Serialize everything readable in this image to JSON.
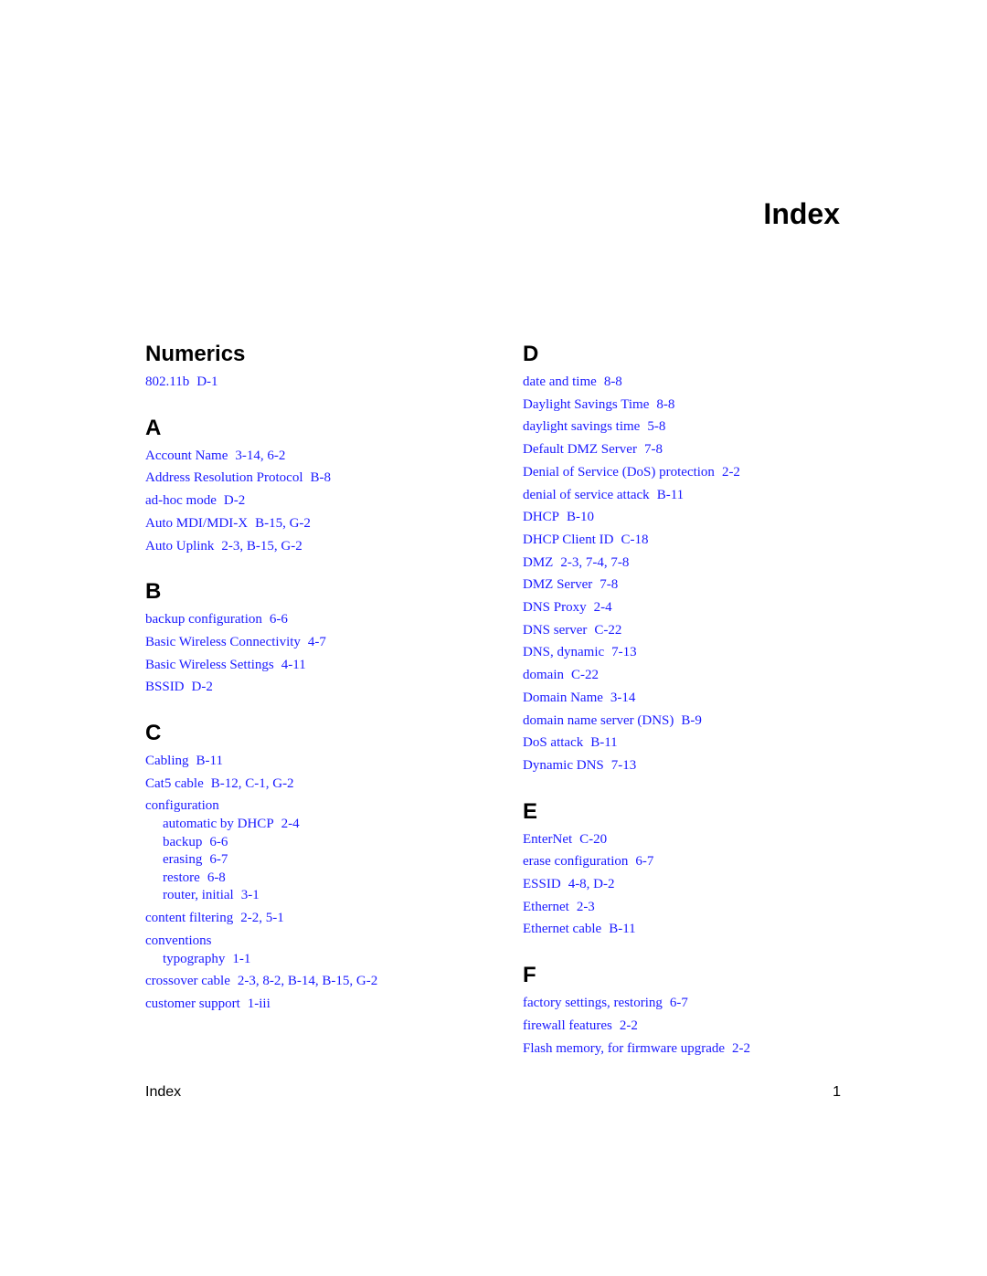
{
  "page": {
    "title": "Index",
    "link_color": "#1a1aff"
  },
  "sections": {
    "numerics": {
      "letter": "Numerics",
      "entries": [
        {
          "term": "802.11b",
          "pages": "D-1"
        }
      ]
    },
    "a": {
      "letter": "A",
      "entries": [
        {
          "term": "Account Name",
          "pages": "3-14, 6-2"
        },
        {
          "term": "Address Resolution Protocol",
          "pages": "B-8"
        },
        {
          "term": "ad-hoc mode",
          "pages": "D-2"
        },
        {
          "term": "Auto MDI/MDI-X",
          "pages": "B-15, G-2"
        },
        {
          "term": "Auto Uplink",
          "pages": "2-3, B-15, G-2"
        }
      ]
    },
    "b": {
      "letter": "B",
      "entries": [
        {
          "term": "backup configuration",
          "pages": "6-6"
        },
        {
          "term": "Basic Wireless Connectivity",
          "pages": "4-7"
        },
        {
          "term": "Basic Wireless Settings",
          "pages": "4-11"
        },
        {
          "term": "BSSID",
          "pages": "D-2"
        }
      ]
    },
    "c": {
      "letter": "C",
      "entries": [
        {
          "term": "Cabling",
          "pages": "B-11"
        },
        {
          "term": "Cat5 cable",
          "pages": "B-12, C-1, G-2"
        }
      ],
      "configuration": {
        "term": "configuration",
        "subentries": [
          {
            "term": "automatic by DHCP",
            "pages": "2-4"
          },
          {
            "term": "backup",
            "pages": "6-6"
          },
          {
            "term": "erasing",
            "pages": "6-7"
          },
          {
            "term": "restore",
            "pages": "6-8"
          },
          {
            "term": "router, initial",
            "pages": "3-1"
          }
        ]
      },
      "content_filtering": {
        "term": "content filtering",
        "pages": "2-2, 5-1"
      },
      "conventions": {
        "term": "conventions",
        "subentries": [
          {
            "term": "typography",
            "pages": "1-1"
          }
        ]
      },
      "tail": [
        {
          "term": "crossover cable",
          "pages": "2-3, 8-2, B-14, B-15, G-2"
        },
        {
          "term": "customer support",
          "pages": "1-iii"
        }
      ]
    },
    "d": {
      "letter": "D",
      "entries": [
        {
          "term": "date and time",
          "pages": "8-8"
        },
        {
          "term": "Daylight Savings Time",
          "pages": "8-8"
        },
        {
          "term": "daylight savings time",
          "pages": "5-8"
        },
        {
          "term": "Default DMZ Server",
          "pages": "7-8"
        },
        {
          "term": "Denial of Service (DoS) protection",
          "pages": "2-2"
        },
        {
          "term": "denial of service attack",
          "pages": "B-11"
        },
        {
          "term": "DHCP",
          "pages": "B-10"
        },
        {
          "term": "DHCP Client ID",
          "pages": "C-18"
        },
        {
          "term": "DMZ",
          "pages": "2-3, 7-4, 7-8"
        },
        {
          "term": "DMZ Server",
          "pages": "7-8"
        },
        {
          "term": "DNS Proxy",
          "pages": "2-4"
        },
        {
          "term": "DNS server",
          "pages": "C-22"
        },
        {
          "term": "DNS, dynamic",
          "pages": "7-13"
        },
        {
          "term": "domain",
          "pages": "C-22"
        },
        {
          "term": "Domain Name",
          "pages": "3-14"
        },
        {
          "term": "domain name server (DNS)",
          "pages": "B-9"
        },
        {
          "term": "DoS attack",
          "pages": "B-11"
        },
        {
          "term": "Dynamic DNS",
          "pages": "7-13"
        }
      ]
    },
    "e": {
      "letter": "E",
      "entries": [
        {
          "term": "EnterNet",
          "pages": "C-20"
        },
        {
          "term": "erase configuration",
          "pages": "6-7"
        },
        {
          "term": "ESSID",
          "pages": "4-8, D-2"
        },
        {
          "term": "Ethernet",
          "pages": "2-3"
        },
        {
          "term": "Ethernet cable",
          "pages": "B-11"
        }
      ]
    },
    "f": {
      "letter": "F",
      "entries": [
        {
          "term": "factory settings, restoring",
          "pages": "6-7"
        },
        {
          "term": "firewall features",
          "pages": "2-2"
        },
        {
          "term": "Flash memory, for firmware upgrade",
          "pages": "2-2"
        }
      ]
    }
  },
  "footer": {
    "label": "Index",
    "page_number": "1"
  }
}
